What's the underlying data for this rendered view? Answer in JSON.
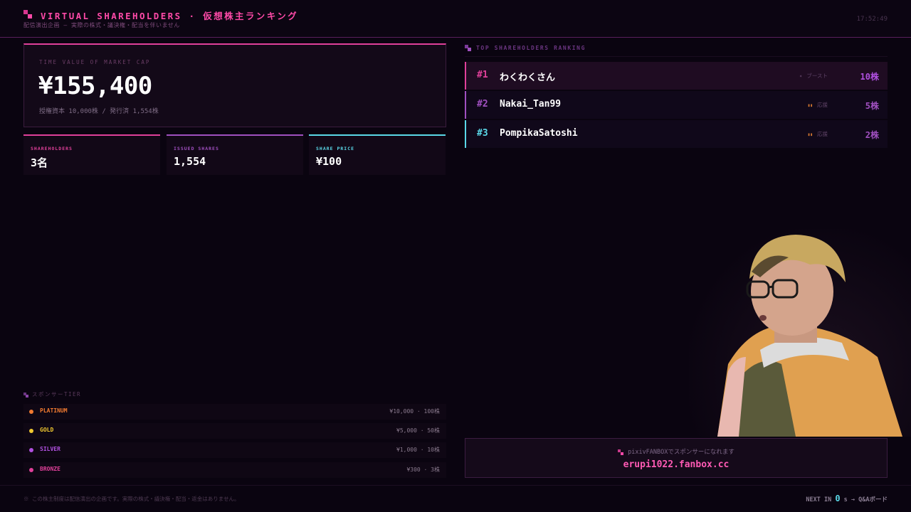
{
  "header": {
    "title": "VIRTUAL SHAREHOLDERS · 仮想株主ランキング",
    "subtitle": "配信演出企画 — 実際の株式・議決権・配当を伴いません",
    "clock": "17:52:49"
  },
  "market_cap": {
    "label": "TIME VALUE OF MARKET CAP",
    "value": "¥155,400",
    "detail": "授権資本 10,000株 / 発行済 1,554株"
  },
  "stats": [
    {
      "label": "SHAREHOLDERS",
      "value": "3名",
      "color": "#e0409a"
    },
    {
      "label": "ISSUED SHARES",
      "value": "1,554",
      "color": "#a050c0"
    },
    {
      "label": "SHARE PRICE",
      "value": "¥100",
      "color": "#5ad8e8"
    }
  ],
  "tiers": {
    "heading": "スポンサーTIER",
    "items": [
      {
        "name": "PLATINUM",
        "price": "¥10,000 · 100株",
        "color": "#f07a30"
      },
      {
        "name": "GOLD",
        "price": "¥5,000 · 50株",
        "color": "#f0c830"
      },
      {
        "name": "SILVER",
        "price": "¥1,000 · 10株",
        "color": "#b050e0"
      },
      {
        "name": "BRONZE",
        "price": "¥300 · 3株",
        "color": "#e0409a"
      }
    ]
  },
  "ranking": {
    "heading": "TOP SHAREHOLDERS RANKING",
    "rows": [
      {
        "pos": "#1",
        "name": "わくわくさん",
        "tag_icon": "rocket-icon",
        "tag_glyph": "✦",
        "tag": "ブースト",
        "shares": "10株",
        "color": "#e0409a"
      },
      {
        "pos": "#2",
        "name": "Nakai_Tan99",
        "tag_icon": "cheer-icon",
        "tag_glyph": "▮▮",
        "tag": "応援",
        "shares": "5株",
        "color": "#a050c0"
      },
      {
        "pos": "#3",
        "name": "PompikaSatoshi",
        "tag_icon": "cheer-icon",
        "tag_glyph": "▮▮",
        "tag": "応援",
        "shares": "2株",
        "color": "#5ad8e8"
      }
    ]
  },
  "fanbox": {
    "line1": "pixivFANBOXでスポンサーになれます",
    "url": "erupi1022.fanbox.cc"
  },
  "footer": {
    "note": "※ この株主制度は配信演出の企画です。実際の株式・議決権・配当・返金はありません。",
    "next_prefix": "NEXT IN",
    "next_num": "0",
    "next_suffix": "s → Q&Aボード"
  }
}
